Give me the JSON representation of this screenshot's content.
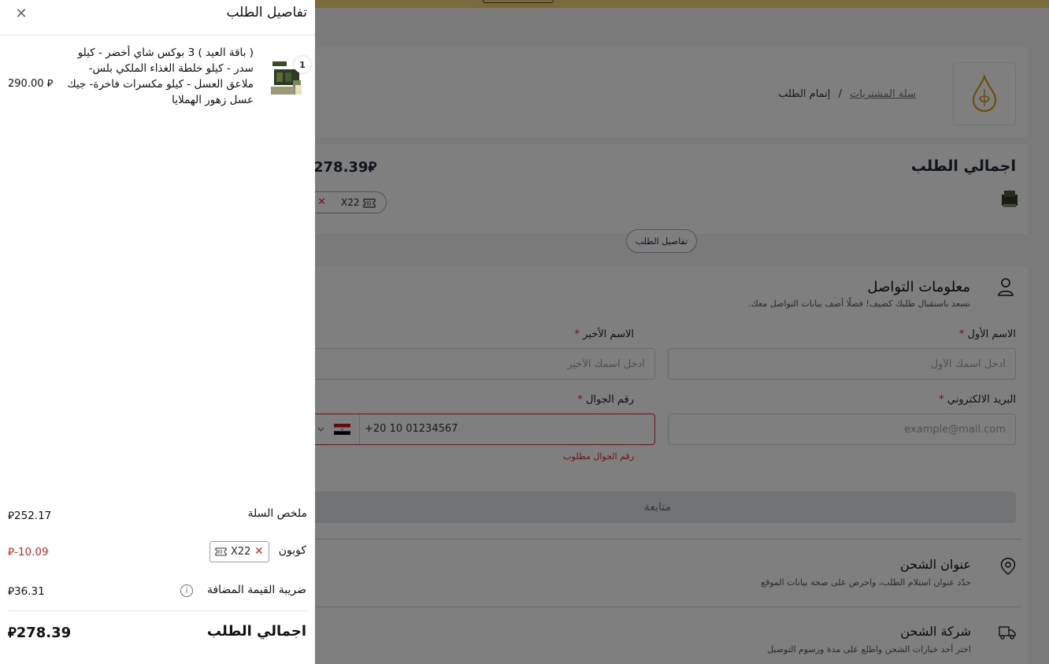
{
  "breadcrumb": {
    "cart": "سلة المشتريات",
    "separator": "/",
    "current": "إتمام الطلب"
  },
  "summary": {
    "title": "اجمالي الطلب",
    "total": "278.39",
    "coupon_code": "X22",
    "details_button": "تفاصيل الطلب"
  },
  "contact": {
    "title": "معلومات التواصل",
    "subtitle": "نسعد باستقبال طلبك كضيف! فضلًا أضف بيانات التواصل معك.",
    "first_name_label": "الاسم الأول",
    "first_name_placeholder": "أدخل اسمك الأول",
    "last_name_label": "الاسم الأخير",
    "last_name_placeholder": "أدخل اسمك الأخير",
    "email_label": "البريد الالكتروني",
    "email_placeholder": "example@mail.com",
    "phone_label": "رقم الجوال",
    "phone_value": "+20 10 01234567",
    "phone_error": "رقم الجوال مطلوب",
    "required_mark": "*",
    "continue": "متابعة"
  },
  "shipping": {
    "title": "عنوان الشحن",
    "subtitle": "حدّد عنوان استلام الطلب، واحرص على صحة بيانات الموقع"
  },
  "carrier": {
    "title": "شركة الشحن",
    "subtitle": "اختر أحد خيارات الشحن واطلع على مدة ورسوم التوصيل"
  },
  "drawer": {
    "title": "تفاصيل الطلب",
    "item": {
      "name": "( باقة العيد ) 3 بوكس شاي أخضر - كيلو سدر - كيلو خلطة الغذاء الملكي بلس- ملاعق العسل - كيلو مكسرات فاخرة- جيك عسل زهور الهملايا",
      "quantity": "1",
      "price": "290.00"
    },
    "cart_summary_label": "ملخص السلة",
    "cart_summary_value": "252.17",
    "coupon_label": "كوبون",
    "coupon_code": "X22",
    "coupon_value": "-10.09",
    "vat_label": "ضريبة القيمة المضافة",
    "vat_value": "36.31",
    "total_label": "اجمالي الطلب",
    "total_value": "278.39"
  },
  "colors": {
    "accent_bar": "#f3d37a",
    "error": "#dc2626",
    "logo_gold": "#d4a017"
  }
}
